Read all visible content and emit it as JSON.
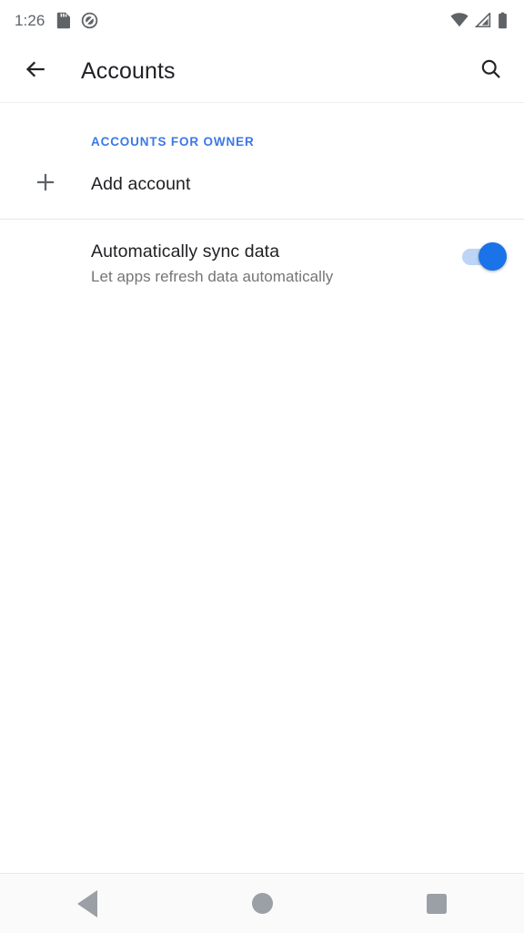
{
  "status_bar": {
    "time": "1:26",
    "icons_left": [
      "sd-card-icon",
      "sync-disabled-icon"
    ],
    "icons_right": [
      "wifi-icon",
      "cellular-signal-icon",
      "battery-icon"
    ]
  },
  "app_bar": {
    "back_icon": "arrow-back-icon",
    "title": "Accounts",
    "search_icon": "search-icon"
  },
  "content": {
    "section_header": "ACCOUNTS FOR OWNER",
    "add_account": {
      "icon": "plus-icon",
      "label": "Add account"
    },
    "auto_sync": {
      "title": "Automatically sync data",
      "subtitle": "Let apps refresh data automatically",
      "toggle_state": "on"
    }
  },
  "nav_bar": {
    "back": "back-triangle-icon",
    "home": "home-circle-icon",
    "recents": "recents-square-icon"
  },
  "colors": {
    "accent_blue": "#3b78e7",
    "toggle_on": "#1a73e8",
    "toggle_track": "#bdd4f7",
    "primary_text": "#202124",
    "secondary_text": "#757575",
    "icon_gray": "#5f6368",
    "nav_icon": "#9aa0a6",
    "background": "#ffffff"
  }
}
